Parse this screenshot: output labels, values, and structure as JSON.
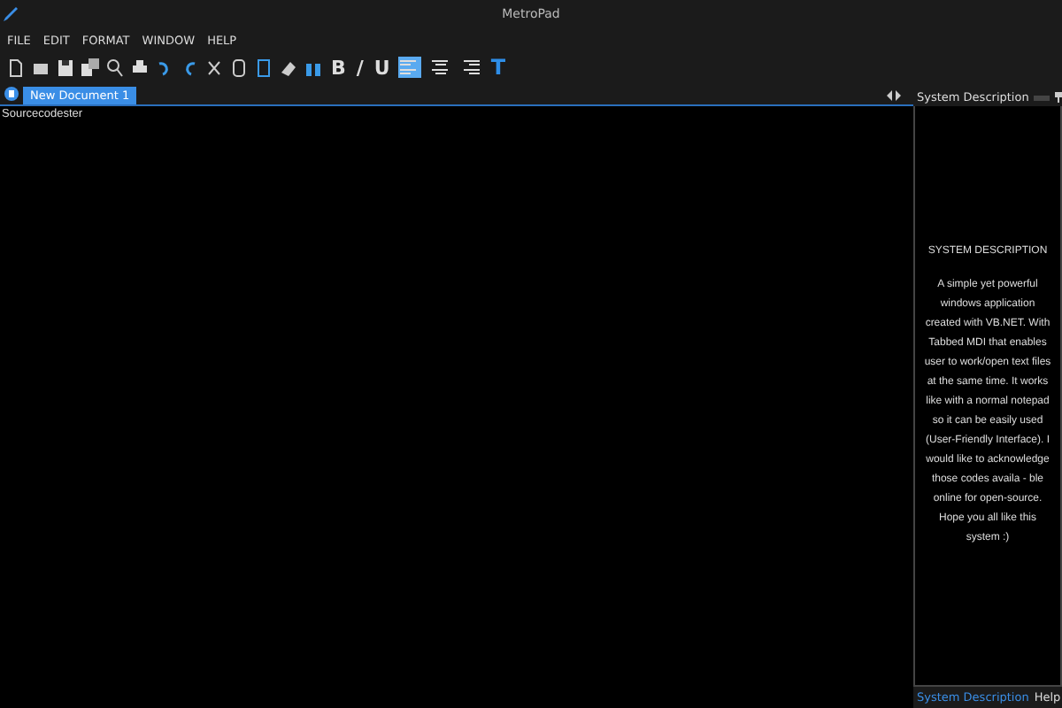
{
  "window": {
    "title": "MetroPad"
  },
  "menu": [
    "FILE",
    "EDIT",
    "FORMAT",
    "WINDOW",
    "HELP"
  ],
  "format_buttons": [
    {
      "label": "B"
    },
    {
      "label": "/"
    },
    {
      "label": "U"
    }
  ],
  "align_buttons": [
    {
      "selected": true
    },
    {
      "selected": false
    },
    {
      "selected": false
    }
  ],
  "text_color_button": {
    "label": "T"
  },
  "document_tabs": [
    {
      "label": "New Document 1",
      "selected": true
    }
  ],
  "editor": {
    "value": "Sourcecodester"
  },
  "side_panel": {
    "title": "System Description",
    "heading": "SYSTEM DESCRIPTION",
    "body": "A simple yet powerful windows application created with VB.NET. With Tabbed MDI that enables user to work/open text files at the same time. It works like with a normal notepad so it can be easily used (User-Friendly Interface). I would like to acknowledge those codes availa - ble online for open-source. Hope you all like this system :)"
  },
  "panel_tabs": [
    {
      "label": "System Description",
      "selected": true
    },
    {
      "label": "Help",
      "selected": false
    }
  ]
}
